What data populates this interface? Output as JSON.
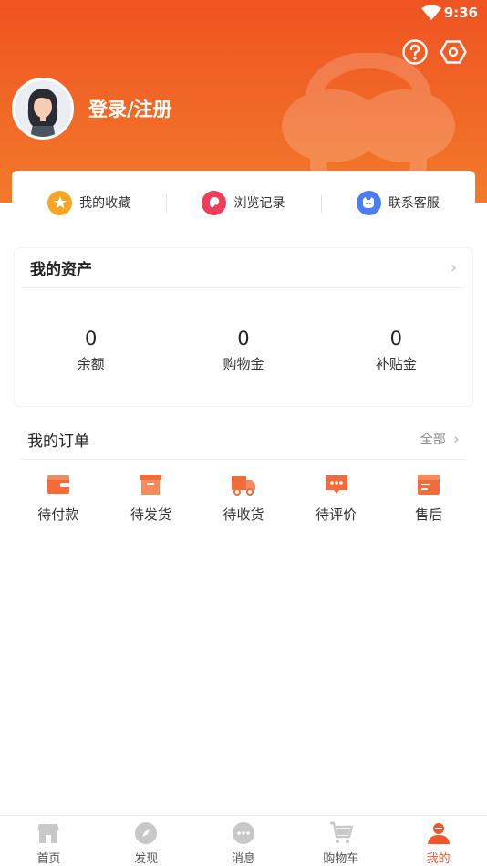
{
  "status": {
    "time": "9:36"
  },
  "header": {
    "login_text": "登录/注册"
  },
  "quick": [
    {
      "label": "我的收藏",
      "icon": "star-icon",
      "color": "#f6a623"
    },
    {
      "label": "浏览记录",
      "icon": "history-icon",
      "color": "#ef3e5a"
    },
    {
      "label": "联系客服",
      "icon": "service-icon",
      "color": "#4a7cf2"
    }
  ],
  "assets": {
    "title": "我的资产",
    "items": [
      {
        "value": "0",
        "label": "余额"
      },
      {
        "value": "0",
        "label": "购物金"
      },
      {
        "value": "0",
        "label": "补贴金"
      }
    ]
  },
  "orders": {
    "title": "我的订单",
    "all_label": "全部",
    "items": [
      {
        "label": "待付款",
        "icon": "wallet-icon"
      },
      {
        "label": "待发货",
        "icon": "box-icon"
      },
      {
        "label": "待收货",
        "icon": "truck-icon"
      },
      {
        "label": "待评价",
        "icon": "comment-icon"
      },
      {
        "label": "售后",
        "icon": "aftersale-icon"
      }
    ]
  },
  "tabs": [
    {
      "label": "首页",
      "icon": "home-icon"
    },
    {
      "label": "发现",
      "icon": "compass-icon"
    },
    {
      "label": "消息",
      "icon": "message-icon"
    },
    {
      "label": "购物车",
      "icon": "cart-icon"
    },
    {
      "label": "我的",
      "icon": "profile-icon",
      "active": true
    }
  ],
  "colors": {
    "accent": "#f0562a",
    "header_top": "#ef5322",
    "header_bottom": "#f27a2a"
  }
}
